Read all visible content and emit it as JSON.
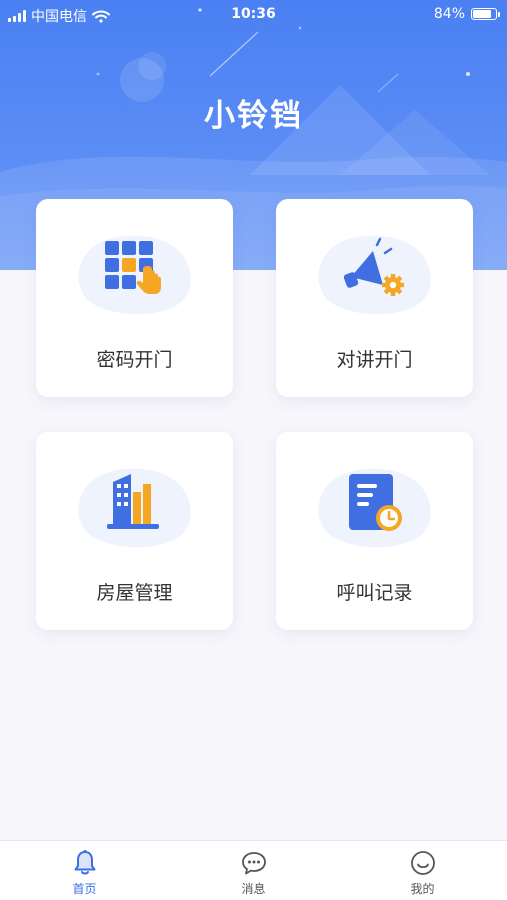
{
  "status_bar": {
    "carrier": "中国电信",
    "time": "10:36",
    "battery": "84%",
    "battery_level": 0.84
  },
  "app": {
    "title": "小铃铛"
  },
  "grid": [
    {
      "label": "密码开门",
      "icon": "keypad-icon"
    },
    {
      "label": "对讲开门",
      "icon": "megaphone-gear-icon"
    },
    {
      "label": "房屋管理",
      "icon": "building-icon"
    },
    {
      "label": "呼叫记录",
      "icon": "call-log-document-icon"
    }
  ],
  "tabbar": [
    {
      "label": "首页",
      "icon": "bell-icon",
      "active": true
    },
    {
      "label": "消息",
      "icon": "chat-bubble-icon",
      "active": false
    },
    {
      "label": "我的",
      "icon": "smiley-face-icon",
      "active": false
    }
  ],
  "colors": {
    "primary": "#4a80f2",
    "accent": "#f5a623",
    "icon_blue": "#3f6fe0",
    "active_tab": "#3b6fe8"
  }
}
